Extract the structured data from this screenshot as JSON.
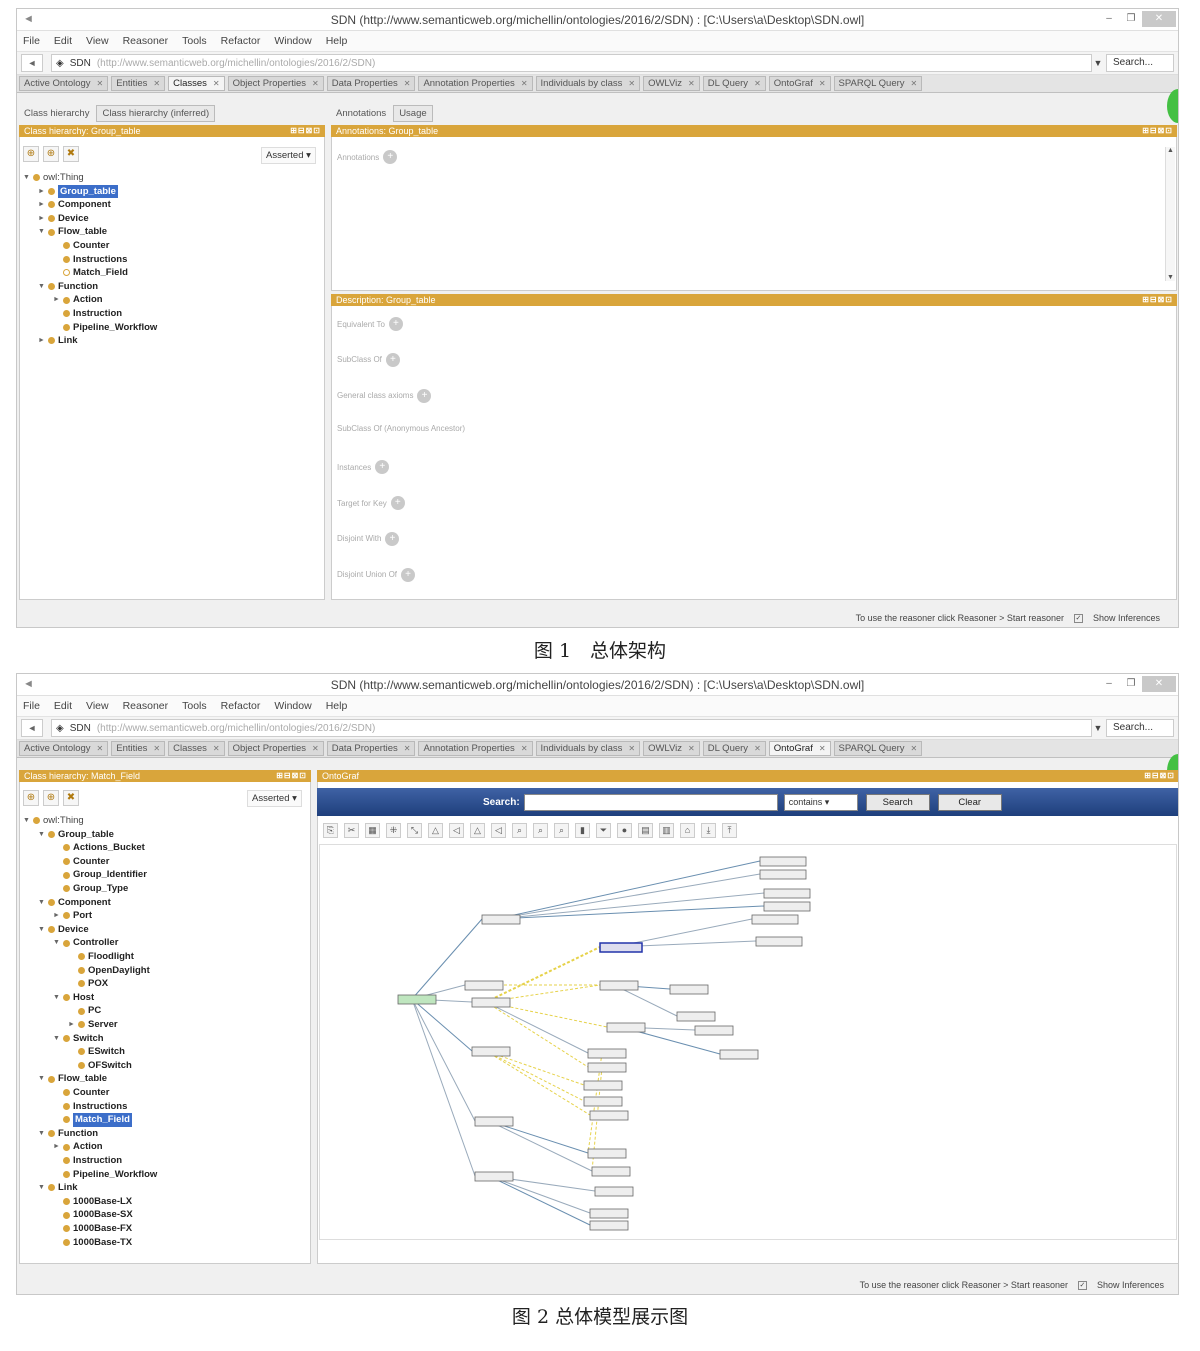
{
  "window": {
    "title": "SDN (http://www.semanticweb.org/michellin/ontologies/2016/2/SDN) : [C:\\Users\\a\\Desktop\\SDN.owl]",
    "title2": "SDN (http://www.semanticweb.org/michellin/ontologies/2016/2/SDN) : [C:\\Users\\a\\Desktop\\SDN.owl]"
  },
  "menu1": [
    "File",
    "Edit",
    "View",
    "Reasoner",
    "Tools",
    "Refactor",
    "Window",
    "Help"
  ],
  "menu2": [
    "File",
    "Edit",
    "View",
    "Reasoner",
    "Tools",
    "Refactor",
    "Window",
    "Help"
  ],
  "address": {
    "ontology": "SDN",
    "url": "(http://www.semanticweb.org/michellin/ontologies/2016/2/SDN)",
    "search_placeholder": "Search..."
  },
  "tabs": [
    "Active Ontology",
    "Entities",
    "Classes",
    "Object Properties",
    "Data Properties",
    "Annotation Properties",
    "Individuals by class",
    "OWLViz",
    "DL Query",
    "OntoGraf",
    "SPARQL Query"
  ],
  "screen1": {
    "subtabs_left": [
      "Class hierarchy",
      "Class hierarchy (inferred)"
    ],
    "subtabs_right": [
      "Annotations",
      "Usage"
    ],
    "left_header": "Class hierarchy: Group_table",
    "ann_header": "Annotations: Group_table",
    "desc_header": "Description: Group_table",
    "header_controls": "⊞⊟⊠⊡",
    "asserted": "Asserted",
    "annotations_label": "Annotations",
    "desc_items": [
      "Equivalent To",
      "SubClass Of",
      "General class axioms",
      "SubClass Of (Anonymous Ancestor)",
      "Instances",
      "Target for Key",
      "Disjoint With",
      "Disjoint Union Of"
    ],
    "status": "To use the reasoner click Reasoner > Start reasoner",
    "show_inferences": "Show Inferences",
    "tree": [
      {
        "label": "owl:Thing",
        "level": 0,
        "tw": "▼",
        "type": "root"
      },
      {
        "label": "Group_table",
        "level": 1,
        "tw": "►",
        "type": "sel"
      },
      {
        "label": "Component",
        "level": 1,
        "tw": "►",
        "type": "n"
      },
      {
        "label": "Device",
        "level": 1,
        "tw": "►",
        "type": "n"
      },
      {
        "label": "Flow_table",
        "level": 1,
        "tw": "▼",
        "type": "n"
      },
      {
        "label": "Counter",
        "level": 2,
        "tw": "",
        "type": "n"
      },
      {
        "label": "Instructions",
        "level": 2,
        "tw": "",
        "type": "n"
      },
      {
        "label": "Match_Field",
        "level": 2,
        "tw": "",
        "type": "hollow"
      },
      {
        "label": "Function",
        "level": 1,
        "tw": "▼",
        "type": "n"
      },
      {
        "label": "Action",
        "level": 2,
        "tw": "►",
        "type": "n"
      },
      {
        "label": "Instruction",
        "level": 2,
        "tw": "",
        "type": "n"
      },
      {
        "label": "Pipeline_Workflow",
        "level": 2,
        "tw": "",
        "type": "n"
      },
      {
        "label": "Link",
        "level": 1,
        "tw": "►",
        "type": "n"
      }
    ]
  },
  "screen2": {
    "left_header": "Class hierarchy: Match_Field",
    "graf_header": "OntoGraf",
    "header_controls": "⊞⊟⊠⊡",
    "asserted": "Asserted",
    "search_label": "Search:",
    "search_value": "",
    "match_mode": "contains",
    "search_button": "Search",
    "clear_button": "Clear",
    "status": "To use the reasoner click Reasoner > Start reasoner",
    "show_inferences": "Show Inferences",
    "tree": [
      {
        "label": "owl:Thing",
        "level": 0,
        "tw": "▼",
        "type": "root"
      },
      {
        "label": "Group_table",
        "level": 1,
        "tw": "▼",
        "type": "n"
      },
      {
        "label": "Actions_Bucket",
        "level": 2,
        "tw": "",
        "type": "n"
      },
      {
        "label": "Counter",
        "level": 2,
        "tw": "",
        "type": "n"
      },
      {
        "label": "Group_Identifier",
        "level": 2,
        "tw": "",
        "type": "n"
      },
      {
        "label": "Group_Type",
        "level": 2,
        "tw": "",
        "type": "n"
      },
      {
        "label": "Component",
        "level": 1,
        "tw": "▼",
        "type": "n"
      },
      {
        "label": "Port",
        "level": 2,
        "tw": "►",
        "type": "n"
      },
      {
        "label": "Device",
        "level": 1,
        "tw": "▼",
        "type": "n"
      },
      {
        "label": "Controller",
        "level": 2,
        "tw": "▼",
        "type": "n"
      },
      {
        "label": "Floodlight",
        "level": 3,
        "tw": "",
        "type": "n"
      },
      {
        "label": "OpenDaylight",
        "level": 3,
        "tw": "",
        "type": "n"
      },
      {
        "label": "POX",
        "level": 3,
        "tw": "",
        "type": "n"
      },
      {
        "label": "Host",
        "level": 2,
        "tw": "▼",
        "type": "n"
      },
      {
        "label": "PC",
        "level": 3,
        "tw": "",
        "type": "n"
      },
      {
        "label": "Server",
        "level": 3,
        "tw": "►",
        "type": "n"
      },
      {
        "label": "Switch",
        "level": 2,
        "tw": "▼",
        "type": "n"
      },
      {
        "label": "ESwitch",
        "level": 3,
        "tw": "",
        "type": "n"
      },
      {
        "label": "OFSwitch",
        "level": 3,
        "tw": "",
        "type": "n"
      },
      {
        "label": "Flow_table",
        "level": 1,
        "tw": "▼",
        "type": "n"
      },
      {
        "label": "Counter",
        "level": 2,
        "tw": "",
        "type": "n"
      },
      {
        "label": "Instructions",
        "level": 2,
        "tw": "",
        "type": "n"
      },
      {
        "label": "Match_Field",
        "level": 2,
        "tw": "",
        "type": "sel"
      },
      {
        "label": "Function",
        "level": 1,
        "tw": "▼",
        "type": "n"
      },
      {
        "label": "Action",
        "level": 2,
        "tw": "►",
        "type": "n"
      },
      {
        "label": "Instruction",
        "level": 2,
        "tw": "",
        "type": "n"
      },
      {
        "label": "Pipeline_Workflow",
        "level": 2,
        "tw": "",
        "type": "n"
      },
      {
        "label": "Link",
        "level": 1,
        "tw": "▼",
        "type": "n"
      },
      {
        "label": "1000Base-LX",
        "level": 2,
        "tw": "",
        "type": "n"
      },
      {
        "label": "1000Base-SX",
        "level": 2,
        "tw": "",
        "type": "n"
      },
      {
        "label": "1000Base-FX",
        "level": 2,
        "tw": "",
        "type": "n"
      },
      {
        "label": "1000Base-TX",
        "level": 2,
        "tw": "",
        "type": "n"
      }
    ]
  },
  "captions": {
    "fig1": "图 1　总体架构",
    "fig2": "图 2 总体模型展示图"
  },
  "colors": {
    "accent": "#d9a53b",
    "ontograf_bar": "#2a4d8f",
    "selection": "#3c6ec9"
  }
}
